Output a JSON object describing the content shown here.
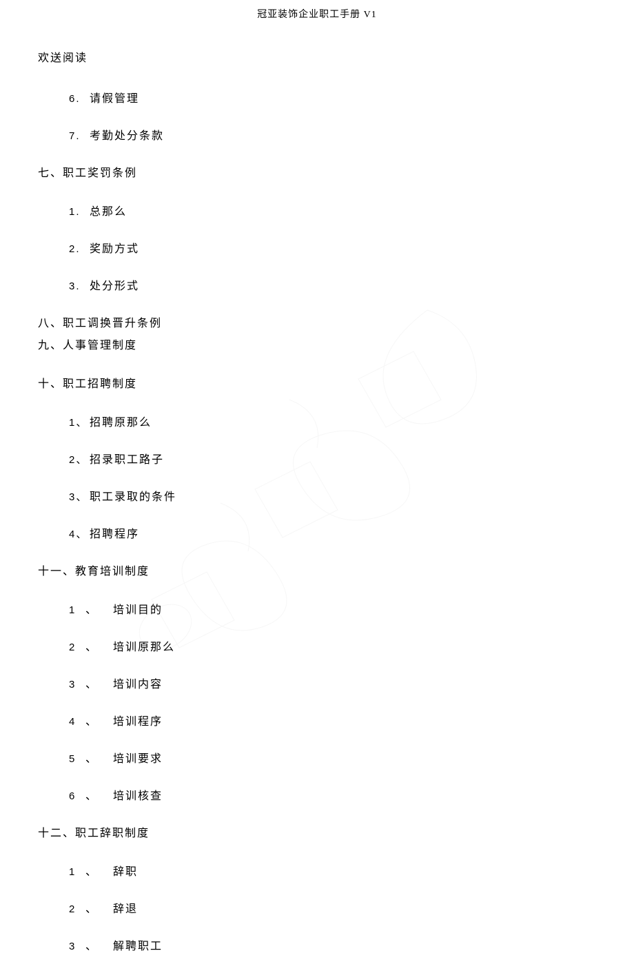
{
  "header": "冠亚装饰企业职工手册 V1",
  "intro": "欢送阅读",
  "pre_items": [
    {
      "num": "6.",
      "text": "请假管理"
    },
    {
      "num": "7.",
      "text": "考勤处分条款"
    }
  ],
  "sections": [
    {
      "title": "七、职工奖罚条例",
      "style": "dot",
      "items": [
        {
          "num": "1.",
          "text": "总那么"
        },
        {
          "num": "2.",
          "text": "奖励方式"
        },
        {
          "num": "3.",
          "text": "处分形式"
        }
      ]
    },
    {
      "title": "八、职工调换晋升条例",
      "style": "none",
      "tight": true,
      "items": []
    },
    {
      "title": "九、人事管理制度",
      "style": "none",
      "items": []
    },
    {
      "title": "十、职工招聘制度",
      "style": "cn",
      "items": [
        {
          "num": "1、",
          "text": "招聘原那么"
        },
        {
          "num": "2、",
          "text": "招录职工路子"
        },
        {
          "num": "3、",
          "text": "职工录取的条件"
        },
        {
          "num": "4、",
          "text": "招聘程序"
        }
      ]
    },
    {
      "title": "十一、教育培训制度",
      "style": "wide",
      "items": [
        {
          "num": "1",
          "sep": "、",
          "text": "培训目的"
        },
        {
          "num": "2",
          "sep": "、",
          "text": "培训原那么"
        },
        {
          "num": "3",
          "sep": "、",
          "text": "培训内容"
        },
        {
          "num": "4",
          "sep": "、",
          "text": "培训程序"
        },
        {
          "num": "5",
          "sep": "、",
          "text": "培训要求"
        },
        {
          "num": "6",
          "sep": "、",
          "text": "培训核查"
        }
      ]
    },
    {
      "title": "十二、职工辞职制度",
      "style": "wide",
      "items": [
        {
          "num": "1",
          "sep": "、",
          "text": "辞职"
        },
        {
          "num": "2",
          "sep": "、",
          "text": "辞退"
        },
        {
          "num": "3",
          "sep": "、",
          "text": "解聘职工"
        }
      ]
    }
  ]
}
